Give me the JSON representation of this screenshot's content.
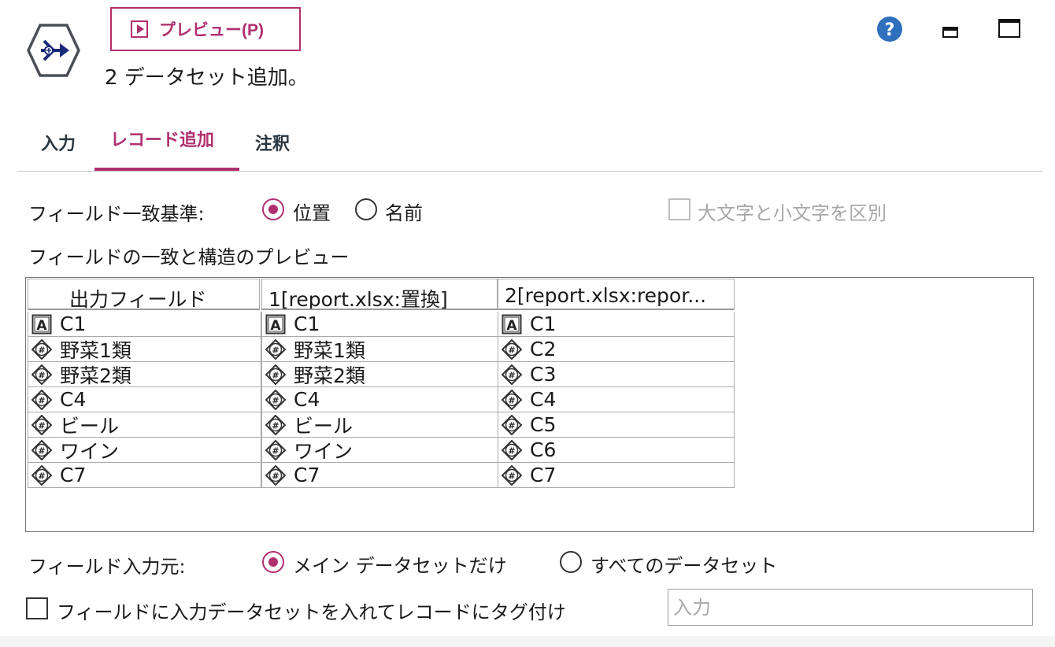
{
  "header": {
    "preview_label": "プレビュー(P)",
    "subtitle": "2 データセット追加。"
  },
  "tabs": [
    {
      "label": "入力",
      "active": false
    },
    {
      "label": "レコード追加",
      "active": true
    },
    {
      "label": "注釈",
      "active": false
    }
  ],
  "match": {
    "label": "フィールド一致基準:",
    "options": [
      {
        "label": "位置",
        "selected": true
      },
      {
        "label": "名前",
        "selected": false
      }
    ],
    "case_label": "大文字と小文字を区別",
    "case_checked": false,
    "case_enabled": false
  },
  "preview_label": "フィールドの一致と構造のプレビュー",
  "table": {
    "headers": [
      "出力フィールド",
      "1[report.xlsx:置換]",
      "2[report.xlsx:repor..."
    ],
    "rows": [
      [
        {
          "icon": "string-icon",
          "text": "C1"
        },
        {
          "icon": "string-icon",
          "text": "C1"
        },
        {
          "icon": "string-icon",
          "text": "C1"
        }
      ],
      [
        {
          "icon": "numeric-icon",
          "text": "野菜1類"
        },
        {
          "icon": "numeric-icon",
          "text": "野菜1類"
        },
        {
          "icon": "numeric-icon",
          "text": "C2"
        }
      ],
      [
        {
          "icon": "numeric-icon",
          "text": "野菜2類"
        },
        {
          "icon": "numeric-icon",
          "text": "野菜2類"
        },
        {
          "icon": "numeric-icon",
          "text": "C3"
        }
      ],
      [
        {
          "icon": "numeric-icon",
          "text": "C4"
        },
        {
          "icon": "numeric-icon",
          "text": "C4"
        },
        {
          "icon": "numeric-icon",
          "text": "C4"
        }
      ],
      [
        {
          "icon": "numeric-icon",
          "text": "ビール"
        },
        {
          "icon": "numeric-icon",
          "text": "ビール"
        },
        {
          "icon": "numeric-icon",
          "text": "C5"
        }
      ],
      [
        {
          "icon": "numeric-icon",
          "text": "ワイン"
        },
        {
          "icon": "numeric-icon",
          "text": "ワイン"
        },
        {
          "icon": "numeric-icon",
          "text": "C6"
        }
      ],
      [
        {
          "icon": "numeric-icon",
          "text": "C7"
        },
        {
          "icon": "numeric-icon",
          "text": "C7"
        },
        {
          "icon": "numeric-icon",
          "text": "C7"
        }
      ]
    ]
  },
  "source": {
    "label": "フィールド入力元:",
    "options": [
      {
        "label": "メイン データセットだけ",
        "selected": true
      },
      {
        "label": "すべてのデータセット",
        "selected": false
      }
    ]
  },
  "tag": {
    "label": "フィールドに入力データセットを入れてレコードにタグ付け",
    "checked": false,
    "placeholder": "入力",
    "value": ""
  },
  "colors": {
    "accent": "#b0306e",
    "help": "#2f6fbd",
    "node_icon": "#1a2a7a"
  }
}
